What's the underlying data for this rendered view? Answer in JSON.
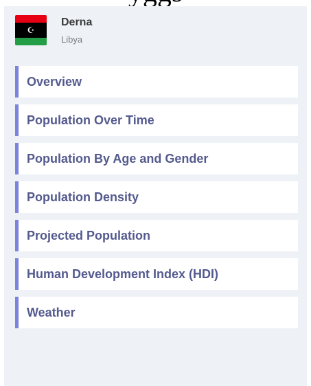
{
  "header": {
    "fragment": "yggs",
    "city": "Derna",
    "country": "Libya",
    "flag": {
      "emblem": "☪",
      "colors": {
        "red": "#e70013",
        "black": "#000000",
        "green": "#239e46"
      }
    }
  },
  "nav": {
    "accent_color": "#7b83dd",
    "items": [
      {
        "label": "Overview"
      },
      {
        "label": "Population Over Time"
      },
      {
        "label": "Population By Age and Gender"
      },
      {
        "label": "Population Density"
      },
      {
        "label": "Projected Population"
      },
      {
        "label": "Human Development Index (HDI)"
      },
      {
        "label": "Weather"
      }
    ]
  }
}
